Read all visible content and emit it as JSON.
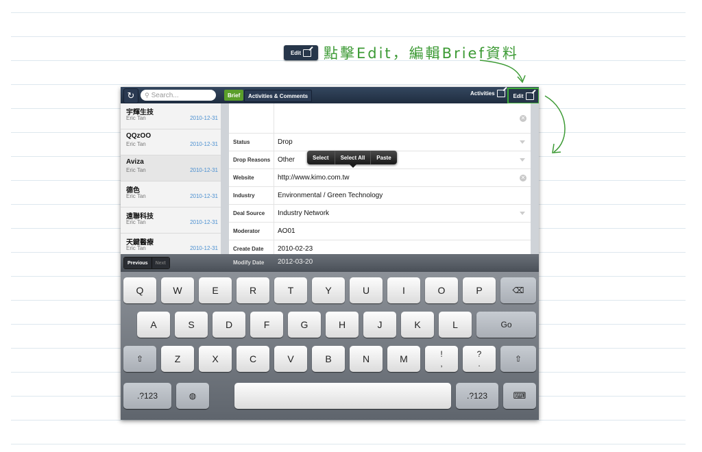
{
  "callout": {
    "button_label": "Edit",
    "text": "點擊Edit，編輯Brief資料"
  },
  "navbar": {
    "search_placeholder": "Search...",
    "tab_brief": "Brief",
    "tab_activities": "Activities & Comments",
    "activities_label": "Activities",
    "edit_label": "Edit"
  },
  "list": {
    "items": [
      {
        "name": "宇輝生技",
        "person": "Eric Tan",
        "date": "2010-12-31"
      },
      {
        "name": "QQzOO",
        "person": "Eric Tan",
        "date": "2010-12-31"
      },
      {
        "name": "Aviza",
        "person": "Eric Tan",
        "date": "2010-12-31"
      },
      {
        "name": "德色",
        "person": "Eric Tan",
        "date": "2010-12-31"
      },
      {
        "name": "遠聯科技",
        "person": "Eric Tan",
        "date": "2010-12-31"
      },
      {
        "name": "天鍵醫療",
        "person": "Eric Tan",
        "date": "2010-12-31"
      }
    ]
  },
  "form": {
    "rows": [
      {
        "label": "",
        "value": ""
      },
      {
        "label": "Status",
        "value": "Drop"
      },
      {
        "label": "Drop Reasons",
        "value": "Other"
      },
      {
        "label": "Website",
        "value": "http://www.kimo.com.tw"
      },
      {
        "label": "Industry",
        "value": "Environmental / Green Technology"
      },
      {
        "label": "Deal Source",
        "value": "Industry Network"
      },
      {
        "label": "Moderator",
        "value": "AO01"
      },
      {
        "label": "Create Date",
        "value": "2010-02-23"
      },
      {
        "label": "Modify Date",
        "value": "2012-03-20"
      }
    ]
  },
  "popup": {
    "select": "Select",
    "select_all": "Select All",
    "paste": "Paste"
  },
  "toolbar": {
    "previous": "Previous",
    "next": "Next"
  },
  "keyboard": {
    "row1": [
      "Q",
      "W",
      "E",
      "R",
      "T",
      "Y",
      "U",
      "I",
      "O",
      "P"
    ],
    "row2": [
      "A",
      "S",
      "D",
      "F",
      "G",
      "H",
      "J",
      "K",
      "L"
    ],
    "go": "Go",
    "row3": [
      "Z",
      "X",
      "C",
      "V",
      "B",
      "N",
      "M"
    ],
    "excl_top": "!",
    "excl_bottom": ",",
    "q_top": "?",
    "q_bottom": ".",
    "num_left": ".?123",
    "num_right": ".?123"
  },
  "colors": {
    "accent_green": "#3fae3a",
    "navbar": "#27364a",
    "link_blue": "#4a8fd0"
  }
}
